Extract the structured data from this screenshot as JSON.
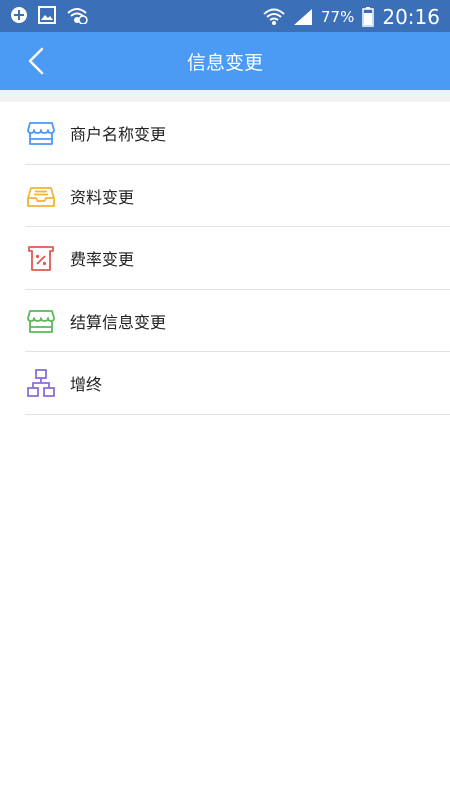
{
  "status_bar": {
    "battery_percent": "77%",
    "time": "20:16",
    "left_icons": [
      "add-circle-icon",
      "image-icon",
      "wifi-question-icon"
    ],
    "right_icons": [
      "wifi-icon",
      "signal-icon",
      "battery-icon"
    ]
  },
  "header": {
    "title": "信息变更",
    "background": "#4b9af3"
  },
  "menu": {
    "items": [
      {
        "label": "商户名称变更",
        "icon": "store-icon",
        "color": "#4b9af3"
      },
      {
        "label": "资料变更",
        "icon": "inbox-tray-icon",
        "color": "#f1b52e"
      },
      {
        "label": "费率变更",
        "icon": "percent-receipt-icon",
        "color": "#e05a4e"
      },
      {
        "label": "结算信息变更",
        "icon": "store-icon",
        "color": "#5bb85b"
      },
      {
        "label": "增终",
        "icon": "org-tree-icon",
        "color": "#8a6fd8"
      }
    ]
  }
}
